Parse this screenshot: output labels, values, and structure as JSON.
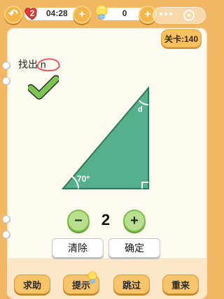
{
  "topbar": {
    "lives": "2",
    "timer": "04:28",
    "hint_count": "0"
  },
  "level": {
    "label": "关卡:140"
  },
  "instruction": {
    "text": "找出 n"
  },
  "triangle": {
    "angle_label_left": "70°",
    "angle_label_top": "d",
    "colors": {
      "fill": "#55b08b",
      "stroke": "#2b7a58"
    }
  },
  "stepper": {
    "minus": "−",
    "value": "2",
    "plus": "+"
  },
  "actions": {
    "clear": "清除",
    "confirm": "确定"
  },
  "bottom": {
    "help": "求助",
    "hint": "提示",
    "skip": "跳过",
    "restart": "重来"
  }
}
